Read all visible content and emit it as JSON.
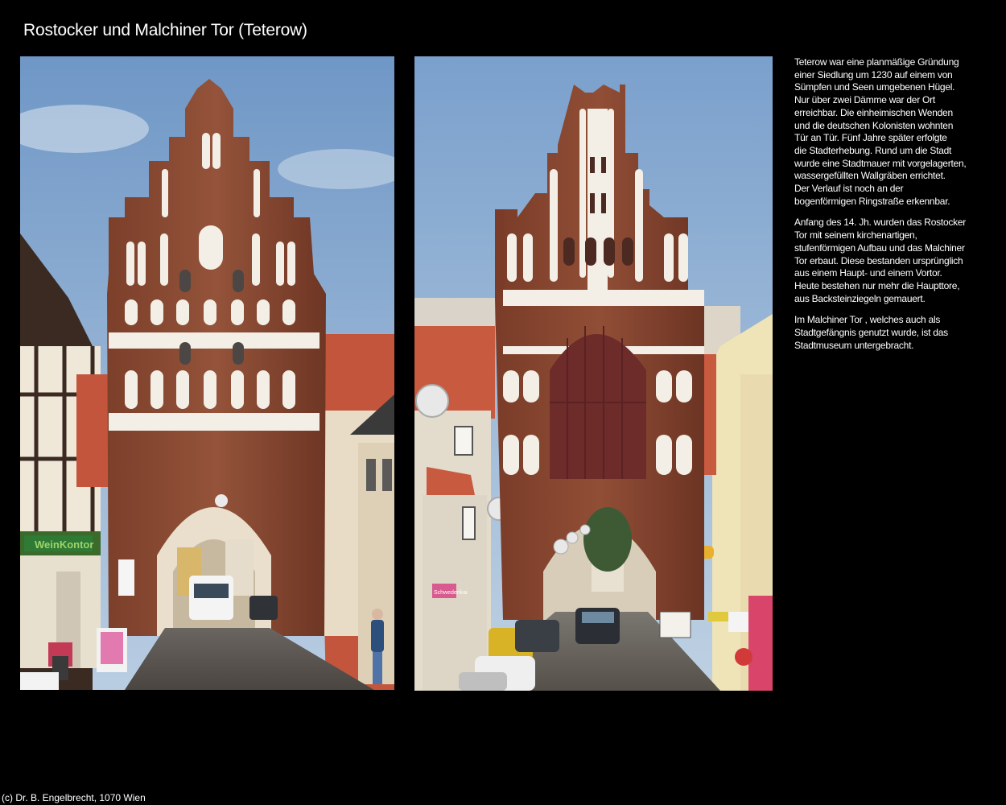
{
  "title": "Rostocker und Malchiner Tor (Teterow)",
  "photos": [
    {
      "label": "Rostocker Tor",
      "signs": {
        "shop_sign": "WeinKontor"
      }
    },
    {
      "label": "Malchiner Tor",
      "signs": {
        "poster": "Schwedenkai"
      }
    }
  ],
  "description": {
    "paragraphs": [
      "Teterow war eine planmäßige Gründung\neiner Siedlung um 1230 auf einem von\nSümpfen und Seen umgebenen Hügel.\nNur über zwei Dämme war der Ort\nerreichbar. Die einheimischen Wenden\nund die deutschen Kolonisten wohnten\nTür an Tür. Fünf Jahre später erfolgte\ndie Stadterhebung. Rund um die Stadt\nwurde eine Stadtmauer mit vorgelagerten,\nwassergefüllten Wallgräben errichtet.\nDer Verlauf ist noch an der\nbogenförmigen Ringstraße erkennbar.",
      "Anfang des 14. Jh. wurden das Rostocker\nTor mit seinem kirchenartigen,\nstufenförmigen Aufbau und das Malchiner\nTor erbaut. Diese bestanden ursprünglich\naus einem Haupt- und einem Vortor.\nHeute bestehen nur mehr die Haupttore,\naus Backsteinziegeln gemauert.",
      "Im Malchiner Tor , welches auch als\nStadtgefängnis genutzt wurde, ist das\nStadtmuseum untergebracht."
    ]
  },
  "copyright": "(c) Dr. B. Engelbrecht, 1070 Wien",
  "colors": {
    "background": "#000000",
    "text": "#ffffff",
    "sky": "#8fb1d6",
    "brick": "#8b4a32",
    "roof": "#c8553e"
  }
}
